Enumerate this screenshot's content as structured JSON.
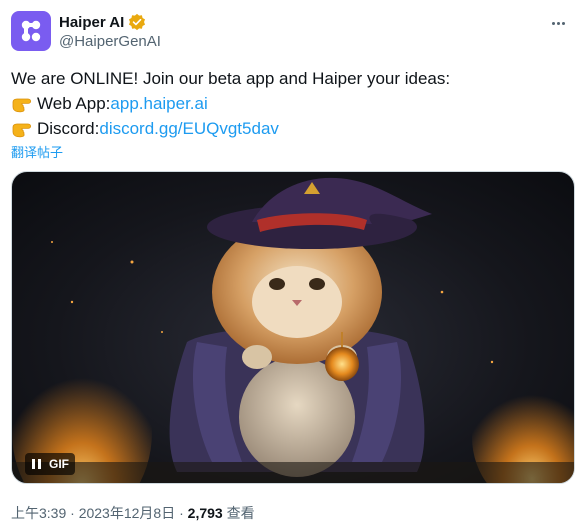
{
  "account": {
    "name": "Haiper AI",
    "handle": "@HaiperGenAI",
    "verified_color": "#f4b400",
    "avatar_color": "#7a5cf0"
  },
  "tweet": {
    "line1": "We are ONLINE! Join our beta app and Haiper your ideas:",
    "web_label": "Web App: ",
    "web_link": "app.haiper.ai",
    "discord_label": "Discord: ",
    "discord_link": "discord.gg/EUQvgt5dav",
    "pointer_icon": "backhand-index-pointing-right-icon",
    "translate": "翻译帖子"
  },
  "media": {
    "gif_badge": "GIF",
    "pause_icon": "pause-icon"
  },
  "meta": {
    "time": "上午3:39",
    "sep1": " · ",
    "date": "2023年12月8日",
    "sep2": " · ",
    "views_count": "2,793",
    "views_label": " 查看"
  },
  "colors": {
    "link": "#1d9bf0",
    "muted": "#536471",
    "text": "#0f1419"
  }
}
